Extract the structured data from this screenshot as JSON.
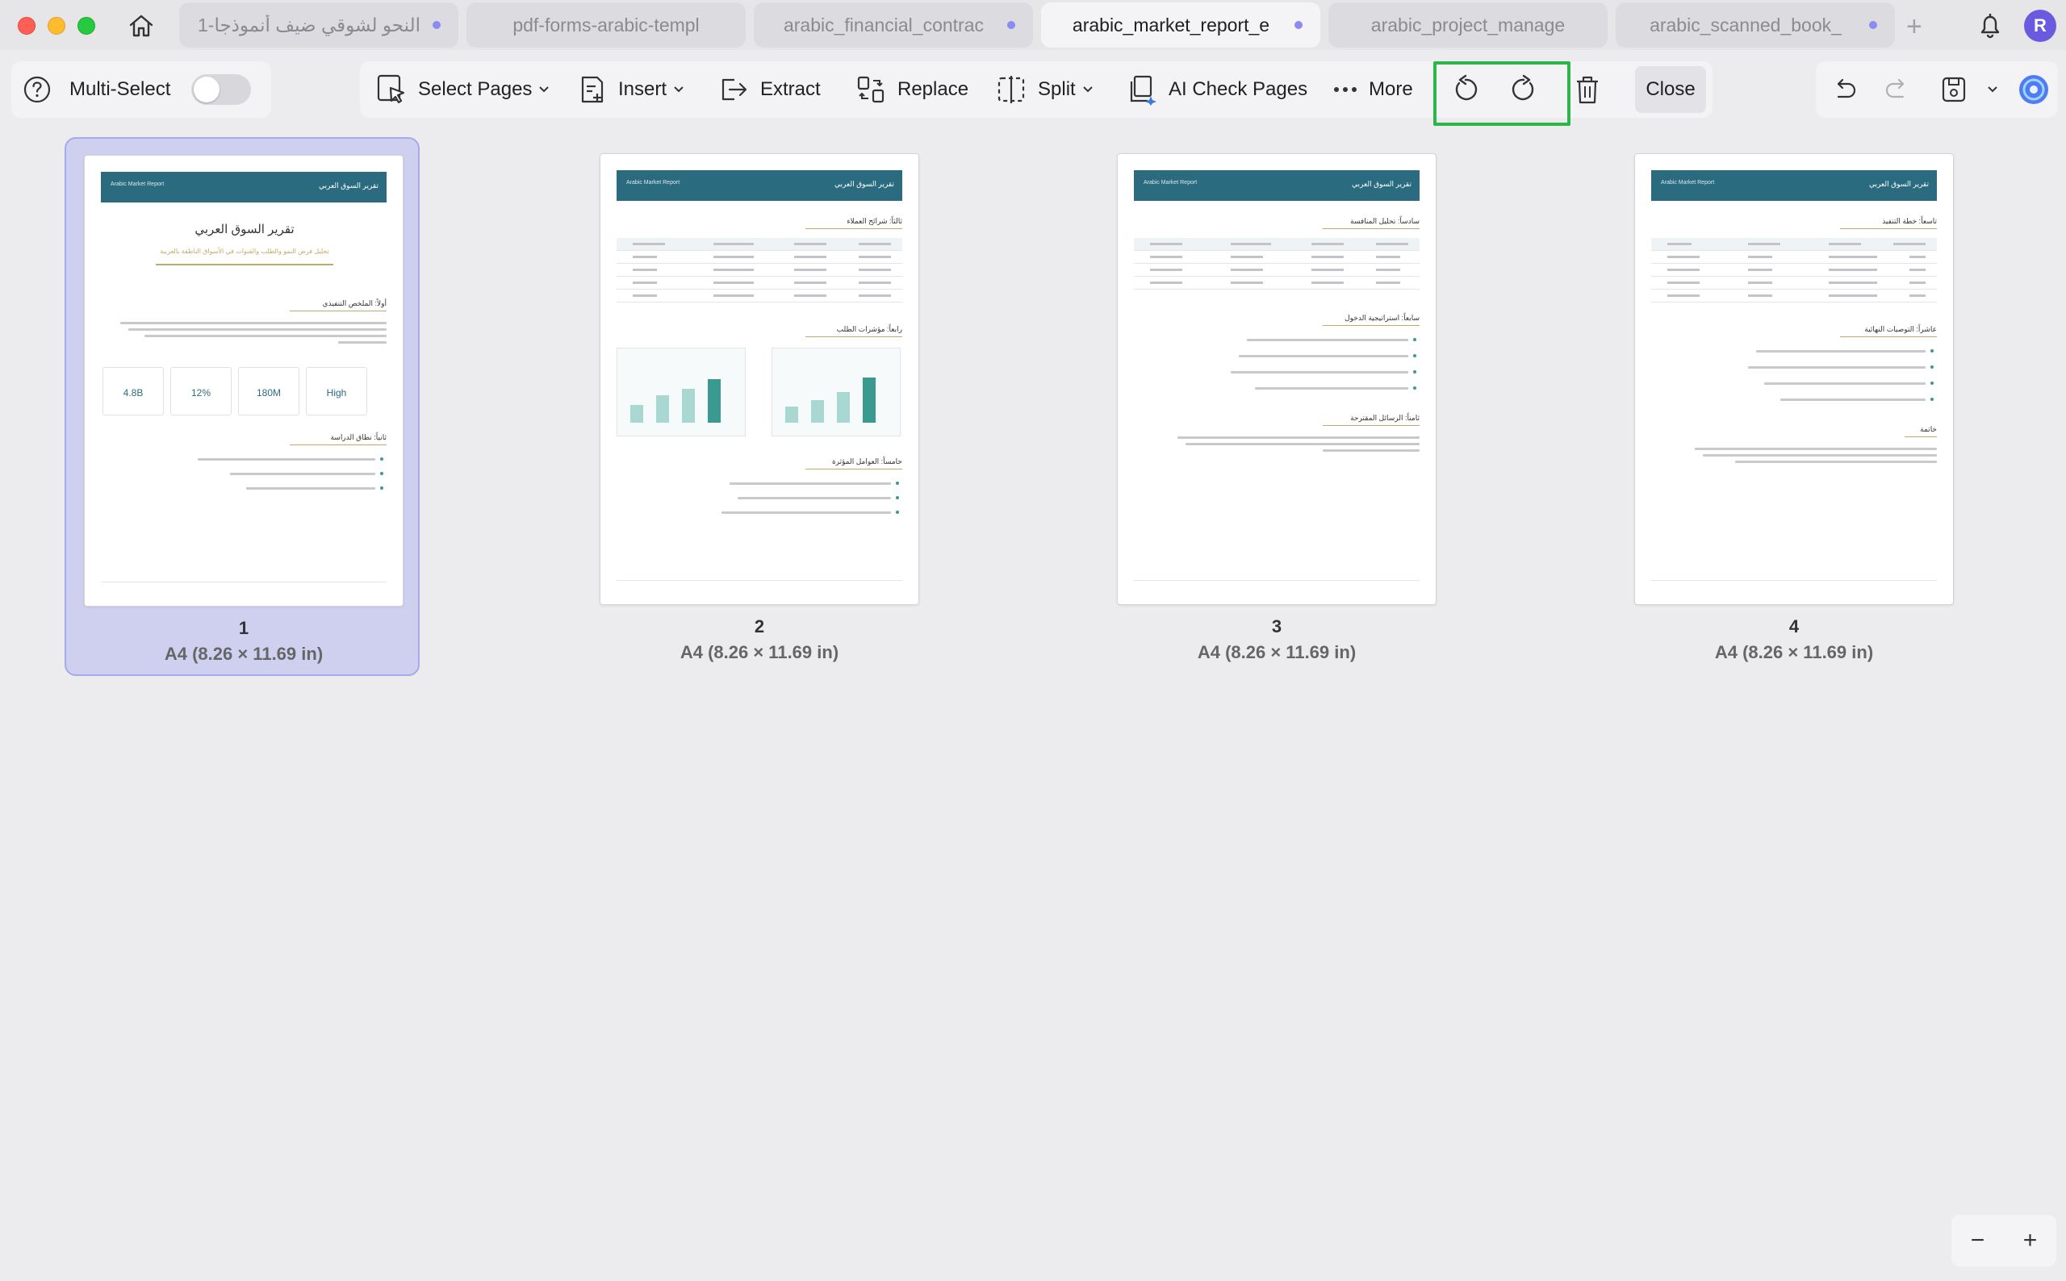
{
  "tabs": [
    {
      "label": "النحو لشوقي ضيف أنموذجا-1",
      "active": false
    },
    {
      "label": "pdf-forms-arabic-templ",
      "active": false
    },
    {
      "label": "arabic_financial_contrac",
      "active": false
    },
    {
      "label": "arabic_market_report_e",
      "active": true
    },
    {
      "label": "arabic_project_manage",
      "active": false
    },
    {
      "label": "arabic_scanned_book_",
      "active": false
    }
  ],
  "user": {
    "avatar_letter": "R"
  },
  "toolbar": {
    "multi_select_label": "Multi-Select",
    "select_pages": "Select Pages",
    "insert": "Insert",
    "extract": "Extract",
    "replace": "Replace",
    "split": "Split",
    "ai_check": "AI Check Pages",
    "more": "More",
    "close": "Close"
  },
  "colors": {
    "accent": "#6a5ae0",
    "selection": "#cfd0ef",
    "highlight": "#2eb54a",
    "report_header": "#2b6b80"
  },
  "pages": [
    {
      "number": "1",
      "size": "A4 (8.26 × 11.69 in)",
      "selected": true
    },
    {
      "number": "2",
      "size": "A4 (8.26 × 11.69 in)",
      "selected": false
    },
    {
      "number": "3",
      "size": "A4 (8.26 × 11.69 in)",
      "selected": false
    },
    {
      "number": "4",
      "size": "A4 (8.26 × 11.69 in)",
      "selected": false
    }
  ],
  "thumb": {
    "header_left": "Arabic Market Report",
    "header_right": "تقرير السوق العربي",
    "p1": {
      "title": "تقرير السوق العربي",
      "subtitle": "تحليل فرص النمو والطلب والقنوات في الأسواق الناطقة بالعربية",
      "h1": "أولاً: الملخص التنفيذي",
      "h2": "ثانياً: نطاق الدراسة",
      "kpis": [
        "4.8B",
        "12%",
        "180M",
        "High"
      ]
    },
    "p2": {
      "h1": "ثالثاً: شرائح العملاء",
      "h2": "رابعاً: مؤشرات الطلب",
      "h3": "خامساً: العوامل المؤثرة"
    },
    "p3": {
      "h1": "سادساً: تحليل المنافسة",
      "h2": "سابعاً: استراتيجية الدخول",
      "h3": "ثامناً: الرسائل المقترحة"
    },
    "p4": {
      "h1": "تاسعاً: خطة التنفيذ",
      "h2": "عاشراً: التوصيات النهائية",
      "h3": "خاتمة"
    }
  },
  "zoom": {
    "minus": "−",
    "plus": "+"
  }
}
